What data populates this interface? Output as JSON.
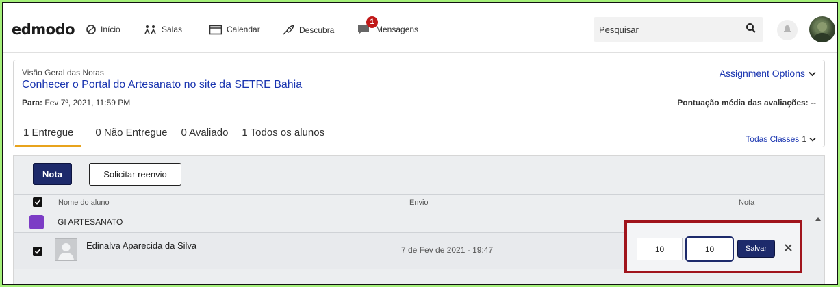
{
  "nav": {
    "logo": "edmodo",
    "items": [
      {
        "label": "Início",
        "icon": "home-icon"
      },
      {
        "label": "Salas",
        "icon": "classes-icon"
      },
      {
        "label": "Calendar",
        "icon": "calendar-icon"
      },
      {
        "label": "Descubra",
        "icon": "rocket-icon"
      },
      {
        "label": "Mensagens",
        "icon": "messages-icon"
      }
    ],
    "messages_badge": "1",
    "search_placeholder": "Pesquisar"
  },
  "assignment": {
    "overview_label": "Visão Geral das Notas",
    "title": "Conhecer o Portal do Artesanato no site da SETRE Bahia",
    "due_label": "Para:",
    "due_value": "Fev 7º, 2021, 11:59 PM",
    "options_label": "Assignment Options",
    "avg_score": "Pontuação média das avaliações: --",
    "all_classes_label": "Todas Classes",
    "all_classes_count": "1"
  },
  "tabs": [
    {
      "label": "1 Entregue",
      "active": true
    },
    {
      "label": "0 Não Entregue",
      "active": false
    },
    {
      "label": "0 Avaliado",
      "active": false
    },
    {
      "label": "1 Todos os alunos",
      "active": false
    }
  ],
  "grading": {
    "grade_button": "Nota",
    "resend_button": "Solicitar reenvio",
    "columns": {
      "name": "Nome do aluno",
      "submission": "Envio",
      "grade": "Nota"
    },
    "group_name": "GI ARTESANATO",
    "student": {
      "name": "Edinalva Aparecida da Silva",
      "submitted": "7 de Fev de 2021 - 19:47",
      "grade_value": "10",
      "grade_total": "10",
      "save_label": "Salvar"
    }
  },
  "colors": {
    "accent_blue": "#1a35b0",
    "button_navy": "#1d2a6b",
    "tab_underline": "#e8a31c",
    "highlight_box": "#a0141c",
    "group_purple": "#7c3cc5",
    "page_border_green": "#a4f07a"
  }
}
